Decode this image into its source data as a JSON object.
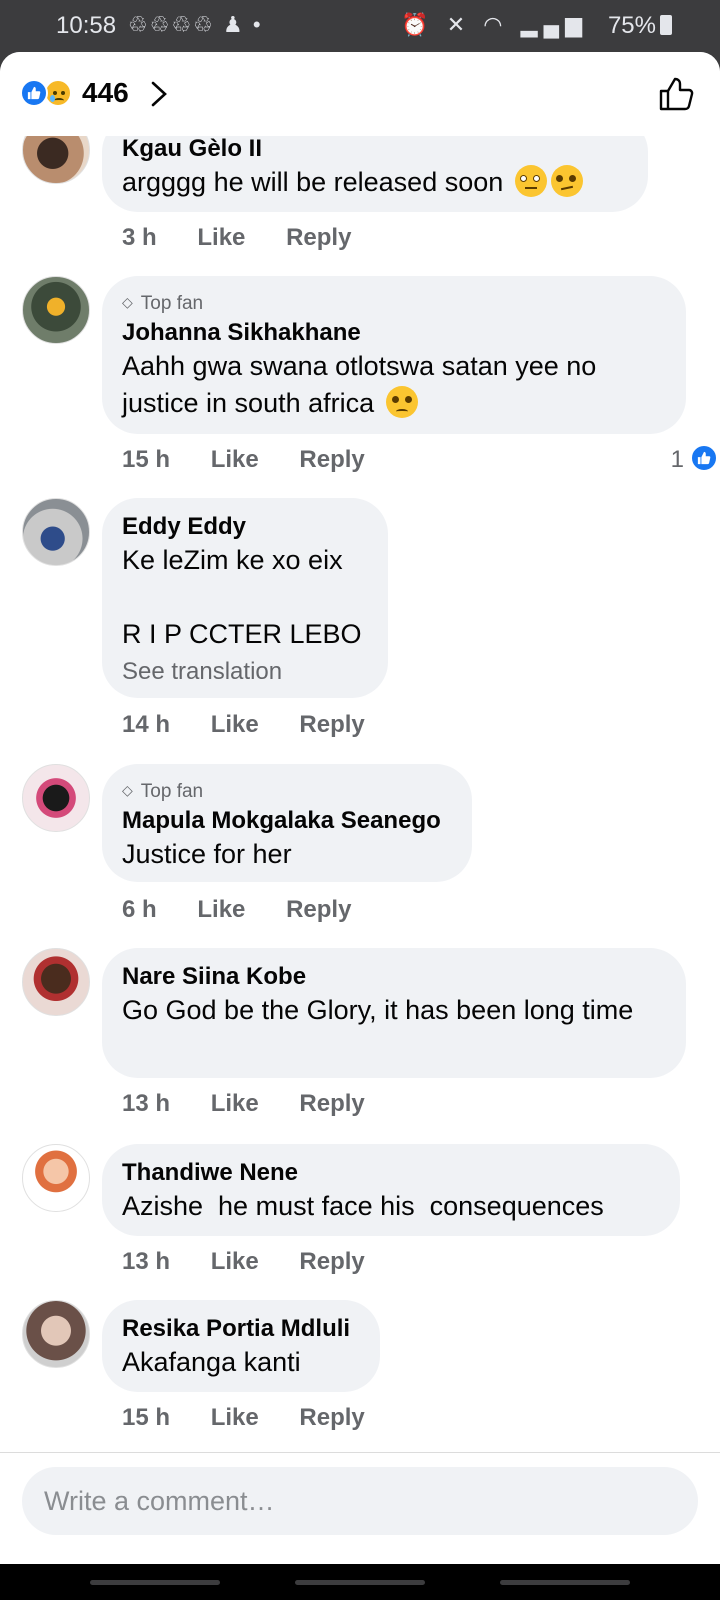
{
  "status_bar": {
    "time": "10:58",
    "battery": "75%"
  },
  "header": {
    "reaction_count": "446",
    "reactions": [
      "like-icon",
      "sad-icon"
    ]
  },
  "comments": [
    {
      "author": "Kgau Gèlo II",
      "text": "argggg he will be released soon",
      "time": "3 h",
      "like": "Like",
      "reply": "Reply",
      "top_fan": false
    },
    {
      "author": "Johanna Sikhakhane",
      "text": "Aahh gwa swana otlotswa satan yee no justice in south africa",
      "time": "15 h",
      "like": "Like",
      "reply": "Reply",
      "top_fan": true,
      "top_fan_label": "Top fan",
      "reactions_count": "1"
    },
    {
      "author": "Eddy Eddy",
      "text": "Ke leZim ke xo eix\n\nR I P CCTER LEBO",
      "see_translation": "See translation",
      "time": "14 h",
      "like": "Like",
      "reply": "Reply",
      "top_fan": false
    },
    {
      "author": "Mapula Mokgalaka Seanego",
      "text": "Justice for her",
      "time": "6 h",
      "like": "Like",
      "reply": "Reply",
      "top_fan": true,
      "top_fan_label": "Top fan"
    },
    {
      "author": "Nare Siina Kobe",
      "text": "Go God be the Glory, it has been long time",
      "time": "13 h",
      "like": "Like",
      "reply": "Reply",
      "top_fan": false
    },
    {
      "author": "Thandiwe Nene",
      "text": "Azishe  he must face his  consequences",
      "time": "13 h",
      "like": "Like",
      "reply": "Reply",
      "top_fan": false
    },
    {
      "author": "Resika Portia Mdluli",
      "text": "Akafanga kanti",
      "time": "15 h",
      "like": "Like",
      "reply": "Reply",
      "top_fan": false
    }
  ],
  "composer": {
    "placeholder": "Write a comment…"
  },
  "colors": {
    "accent": "#1877f2",
    "bubble": "#f0f2f5",
    "meta_text": "#65676b"
  }
}
